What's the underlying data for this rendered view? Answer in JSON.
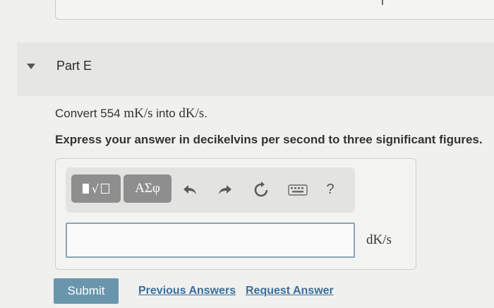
{
  "part": {
    "title": "Part E"
  },
  "question": {
    "prefix": "Convert 554 ",
    "from_unit": "mK/s",
    "middle": " into ",
    "to_unit": "dK/s",
    "suffix": "."
  },
  "instruction": "Express your answer in decikelvins per second to three significant figures.",
  "toolbar": {
    "templates_icon": "templates-radical-icon",
    "symbols_label": "ΑΣφ",
    "undo_icon": "undo-icon",
    "redo_icon": "redo-icon",
    "reset_icon": "reset-icon",
    "keyboard_icon": "keyboard-icon",
    "help_label": "?"
  },
  "answer": {
    "value": "",
    "unit": "dK/s"
  },
  "actions": {
    "submit_label": "Submit",
    "previous_answers_label": "Previous Answers",
    "request_answer_label": "Request Answer"
  },
  "colors": {
    "submit_bg": "#6a96ad",
    "link": "#3a6f9c",
    "toolbar_button": "#8e8e8e",
    "input_border": "#8aa3b8"
  }
}
